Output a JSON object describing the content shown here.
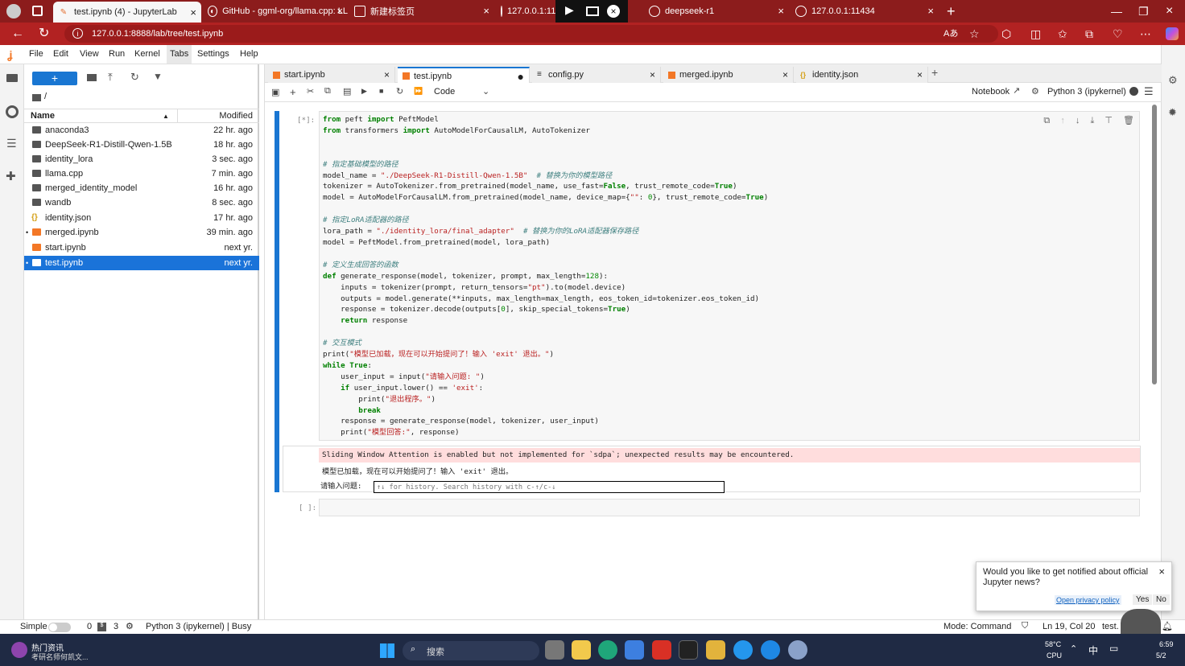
{
  "browser": {
    "tabs": [
      {
        "label": "test.ipynb (4) - JupyterLab",
        "active": true
      },
      {
        "label": "GitHub - ggml-org/llama.cpp: LL"
      },
      {
        "label": "新建标签页"
      },
      {
        "label": "127.0.0.1:11"
      },
      {
        "label": "deepseek-r1"
      },
      {
        "label": "127.0.0.1:11434"
      }
    ],
    "url": "127.0.0.1:8888/lab/tree/test.ipynb"
  },
  "menubar": [
    "File",
    "Edit",
    "View",
    "Run",
    "Kernel",
    "Tabs",
    "Settings",
    "Help"
  ],
  "filebrowser": {
    "new_button": "+",
    "path": "/",
    "col_name": "Name",
    "col_modified": "Modified",
    "files": [
      {
        "name": "anaconda3",
        "modified": "22 hr. ago",
        "type": "folder"
      },
      {
        "name": "DeepSeek-R1-Distill-Qwen-1.5B",
        "modified": "18 hr. ago",
        "type": "folder"
      },
      {
        "name": "identity_lora",
        "modified": "3 sec. ago",
        "type": "folder"
      },
      {
        "name": "llama.cpp",
        "modified": "7 min. ago",
        "type": "folder"
      },
      {
        "name": "merged_identity_model",
        "modified": "16 hr. ago",
        "type": "folder"
      },
      {
        "name": "wandb",
        "modified": "8 sec. ago",
        "type": "folder"
      },
      {
        "name": "identity.json",
        "modified": "17 hr. ago",
        "type": "json"
      },
      {
        "name": "merged.ipynb",
        "modified": "39 min. ago",
        "type": "notebook"
      },
      {
        "name": "start.ipynb",
        "modified": "next yr.",
        "type": "notebook"
      },
      {
        "name": "test.ipynb",
        "modified": "next yr.",
        "type": "notebook",
        "selected": true
      }
    ]
  },
  "notebook_tabs": [
    {
      "label": "start.ipynb"
    },
    {
      "label": "test.ipynb",
      "active": true
    },
    {
      "label": "config.py"
    },
    {
      "label": "merged.ipynb"
    },
    {
      "label": "identity.json"
    }
  ],
  "toolbar": {
    "cell_type": "Code",
    "notebook_label": "Notebook",
    "kernel": "Python 3 (ipykernel)"
  },
  "cell1": {
    "prompt": "[*]:",
    "lines": [
      "from peft import PeftModel",
      "from transformers import AutoModelForCausalLM, AutoTokenizer",
      "",
      "",
      "# 指定基础模型的路径",
      "model_name = \"./DeepSeek-R1-Distill-Qwen-1.5B\"  # 替换为你的模型路径",
      "tokenizer = AutoTokenizer.from_pretrained(model_name, use_fast=False, trust_remote_code=True)",
      "model = AutoModelForCausalLM.from_pretrained(model_name, device_map={\"\": 0}, trust_remote_code=True)",
      "",
      "# 指定LoRA适配器的路径",
      "lora_path = \"./identity_lora/final_adapter\"  # 替换为你的LoRA适配器保存路径",
      "model = PeftModel.from_pretrained(model, lora_path)",
      "",
      "# 定义生成回答的函数",
      "def generate_response(model, tokenizer, prompt, max_length=128):",
      "    inputs = tokenizer(prompt, return_tensors=\"pt\").to(model.device)",
      "    outputs = model.generate(**inputs, max_length=max_length, eos_token_id=tokenizer.eos_token_id)",
      "    response = tokenizer.decode(outputs[0], skip_special_tokens=True)",
      "    return response",
      "",
      "# 交互模式",
      "print(\"模型已加载，现在可以开始提问了！输入 'exit' 退出。\")",
      "while True:",
      "    user_input = input(\"请输入问题: \")",
      "    if user_input.lower() == 'exit':",
      "        print(\"退出程序。\")",
      "        break",
      "    response = generate_response(model, tokenizer, user_input)",
      "    print(\"模型回答:\", response)"
    ]
  },
  "output": {
    "warning": "Sliding Window Attention is enabled but not implemented for `sdpa`; unexpected results may be encountered.",
    "stdout": "模型已加载，现在可以开始提问了！输入 'exit' 退出。",
    "input_prompt": "请输入问题:",
    "input_placeholder": "↑↓ for history. Search history with c-↑/c-↓"
  },
  "cell2": {
    "prompt": "[ ]:"
  },
  "notification": {
    "text": "Would you like to get notified about official Jupyter news?",
    "privacy": "Open privacy policy",
    "yes": "Yes",
    "no": "No"
  },
  "status": {
    "mode_label": "Simple",
    "count0": "0",
    "count1": "3",
    "kernel": "Python 3 (ipykernel) | Busy",
    "mode": "Mode: Command",
    "position": "Ln 19, Col 20",
    "file": "test."
  },
  "taskbar": {
    "news_title": "热门资讯",
    "news_sub": "考研名师何凯文...",
    "search": "搜索",
    "temp": "58°C",
    "cpu": "CPU",
    "lang": "中",
    "time": "6:59",
    "date": "5/2"
  },
  "colors": {
    "browser_red": "#b22222",
    "selection": "#1a73d9",
    "warning_bg": "#fdd"
  }
}
